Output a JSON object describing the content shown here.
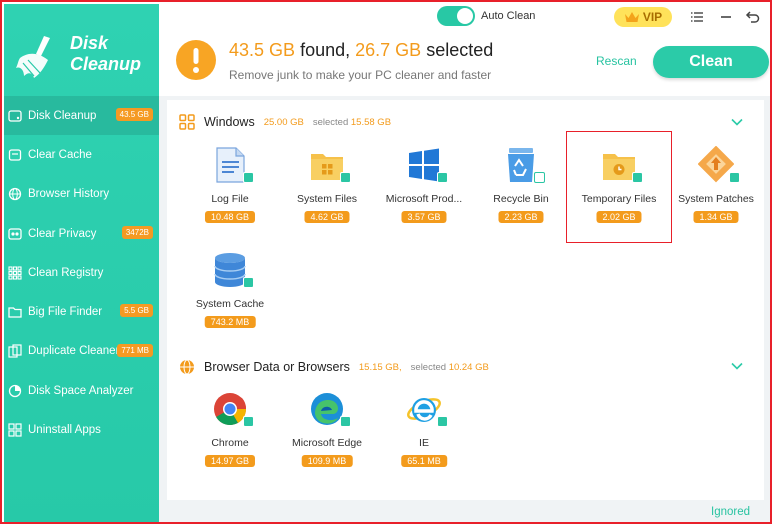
{
  "app": {
    "logo_line1": "Disk",
    "logo_line2": "Cleanup",
    "auto_clean_label": "Auto Clean",
    "auto_clean_on": true,
    "vip_label": "VIP"
  },
  "sidebar": {
    "items": [
      {
        "label": "Disk Cleanup",
        "badge": "43.5 GB",
        "active": true,
        "icon": "disk-icon"
      },
      {
        "label": "Clear Cache",
        "badge": "",
        "active": false,
        "icon": "cache-icon"
      },
      {
        "label": "Browser History",
        "badge": "",
        "active": false,
        "icon": "globe-icon"
      },
      {
        "label": "Clear Privacy",
        "badge": "3472B",
        "active": false,
        "icon": "eye-icon"
      },
      {
        "label": "Clean Registry",
        "badge": "",
        "active": false,
        "icon": "grid-icon"
      },
      {
        "label": "Big File Finder",
        "badge": "5.5 GB",
        "active": false,
        "icon": "folder-icon"
      },
      {
        "label": "Duplicate Cleaner",
        "badge": "771 MB",
        "active": false,
        "icon": "duplicate-icon"
      },
      {
        "label": "Disk Space Analyzer",
        "badge": "",
        "active": false,
        "icon": "analyzer-icon"
      },
      {
        "label": "Uninstall Apps",
        "badge": "",
        "active": false,
        "icon": "apps-icon"
      }
    ]
  },
  "header": {
    "found_value": "43.5 GB",
    "found_label": "found,",
    "selected_value": "26.7 GB",
    "selected_label": "selected",
    "subtitle": "Remove junk to make your PC cleaner and faster",
    "rescan_label": "Rescan",
    "clean_label": "Clean"
  },
  "sections": {
    "windows": {
      "title": "Windows",
      "size": "25.00 GB",
      "selected_prefix": "selected",
      "selected_size": "15.58 GB",
      "tiles": [
        {
          "name": "Log File",
          "size": "10.48 GB",
          "icon": "log-file-icon"
        },
        {
          "name": "System Files",
          "size": "4.62 GB",
          "icon": "system-files-icon"
        },
        {
          "name": "Microsoft Prod...",
          "size": "3.57 GB",
          "icon": "windows-logo-icon"
        },
        {
          "name": "Recycle Bin",
          "size": "2.23 GB",
          "icon": "recycle-bin-icon"
        },
        {
          "name": "Temporary Files",
          "size": "2.02 GB",
          "icon": "temp-folder-icon"
        },
        {
          "name": "System Patches",
          "size": "1.34 GB",
          "icon": "patches-icon"
        },
        {
          "name": "System Cache",
          "size": "743.2 MB",
          "icon": "database-icon"
        }
      ]
    },
    "browsers": {
      "title": "Browser Data or Browsers",
      "size": "15.15 GB,",
      "selected_prefix": "selected",
      "selected_size": "10.24 GB",
      "tiles": [
        {
          "name": "Chrome",
          "size": "14.97 GB",
          "icon": "chrome-icon"
        },
        {
          "name": "Microsoft Edge",
          "size": "109.9 MB",
          "icon": "edge-icon"
        },
        {
          "name": "IE",
          "size": "65.1 MB",
          "icon": "ie-icon"
        }
      ]
    }
  },
  "footer": {
    "ignored_label": "Ignored"
  },
  "colors": {
    "accent": "#2bcba8",
    "orange": "#f39b1c",
    "selection_border": "#e8202a"
  }
}
